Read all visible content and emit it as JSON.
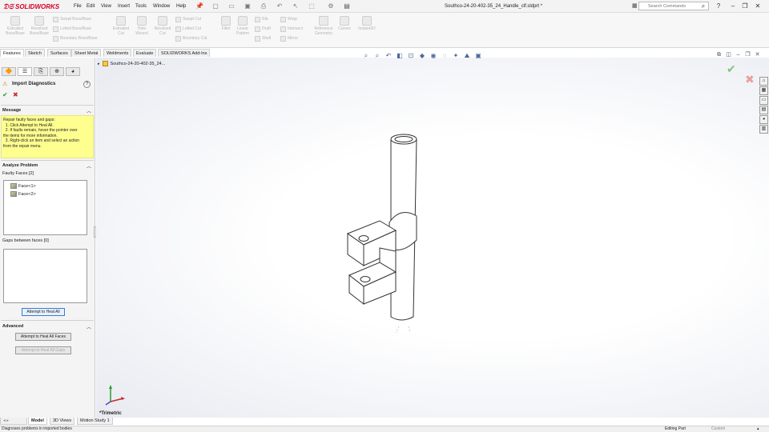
{
  "app": {
    "brand": "SOLIDWORKS",
    "doc_title": "Southco-24-20-402-35_24_Handle_clf.sldprt *"
  },
  "menu": [
    "File",
    "Edit",
    "View",
    "Insert",
    "Tools",
    "Window",
    "Help"
  ],
  "search": {
    "placeholder": "Search Commands"
  },
  "ribbon": {
    "big": [
      {
        "label": "Extruded Boss/Base",
        "l1": "Extruded",
        "l2": "Boss/Base"
      },
      {
        "label": "Revolved Boss/Base",
        "l1": "Revolved",
        "l2": "Boss/Base"
      },
      {
        "label": "Extruded Cut",
        "l1": "Extruded",
        "l2": "Cut"
      },
      {
        "label": "Hole Wizard",
        "l1": "Hole",
        "l2": "Wizard"
      },
      {
        "label": "Revolved Cut",
        "l1": "Revolved",
        "l2": "Cut"
      },
      {
        "label": "Fillet",
        "l1": "Fillet",
        "l2": ""
      },
      {
        "label": "Linear Pattern",
        "l1": "Linear",
        "l2": "Pattern"
      },
      {
        "label": "Reference Geometry",
        "l1": "Reference",
        "l2": "Geometry"
      },
      {
        "label": "Curves",
        "l1": "Curves",
        "l2": ""
      },
      {
        "label": "Instant3D",
        "l1": "Instant3D",
        "l2": ""
      }
    ],
    "small1": [
      "Swept Boss/Base",
      "Lofted Boss/Base",
      "Boundary Boss/Base"
    ],
    "small2": [
      "Swept Cut",
      "Lofted Cut",
      "Boundary Cut"
    ],
    "small3": [
      "Rib",
      "Draft",
      "Shell"
    ],
    "small4": [
      "Wrap",
      "Intersect",
      "Mirror"
    ]
  },
  "command_tabs": [
    "Features",
    "Sketch",
    "Surfaces",
    "Sheet Metal",
    "Weldments",
    "Evaluate",
    "SOLIDWORKS Add-Ins"
  ],
  "panel": {
    "title": "Import Diagnostics",
    "message_header": "Message",
    "message_lines": [
      "Repair faulty faces and gaps:",
      "  1. Click Attempt to Heal All.",
      "  2. If faults remain, hover the pointer over",
      "the items for more information.",
      "  3. Right-click an item and select an action",
      "from the repair menu."
    ],
    "analyze_header": "Analyze Problem",
    "faulty_label": "Faulty Faces [2]",
    "faulty_items": [
      "Face<1>",
      "Face<2>"
    ],
    "gaps_label": "Gaps between faces [0]",
    "heal_all": "Attempt to Heal All",
    "advanced_header": "Advanced",
    "heal_faces": "Attempt to Heal All Faces",
    "heal_gaps": "Attempt to Heal All Gaps"
  },
  "tree": {
    "root": "Southco-24-20-402-35_24..."
  },
  "viewport": {
    "orientation": "*Trimetric"
  },
  "bottom_tabs": [
    "Model",
    "3D Views",
    "Motion Study 1"
  ],
  "status": {
    "hint": "Diagnoses problems in imported bodies",
    "mode": "Editing Part",
    "units": "Custom"
  }
}
